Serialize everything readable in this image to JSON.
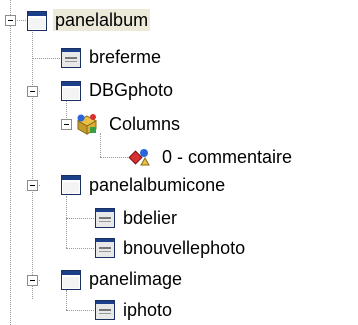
{
  "tree": {
    "nodes": [
      {
        "label": "panelalbum",
        "icon": "form-window-icon",
        "expanded": true,
        "selected": true
      },
      {
        "label": "breferme",
        "icon": "button-control-icon"
      },
      {
        "label": "DBGphoto",
        "icon": "form-window-icon",
        "expanded": true
      },
      {
        "label": "Columns",
        "icon": "columns-collection-icon",
        "expanded": true
      },
      {
        "label": "0 - commentaire",
        "icon": "column-item-icon"
      },
      {
        "label": "panelalbumicone",
        "icon": "form-window-icon",
        "expanded": true
      },
      {
        "label": "bdelier",
        "icon": "button-control-icon"
      },
      {
        "label": "bnouvellephoto",
        "icon": "button-control-icon"
      },
      {
        "label": "panelimage",
        "icon": "form-window-icon",
        "expanded": true
      },
      {
        "label": "iphoto",
        "icon": "button-control-icon"
      }
    ]
  }
}
